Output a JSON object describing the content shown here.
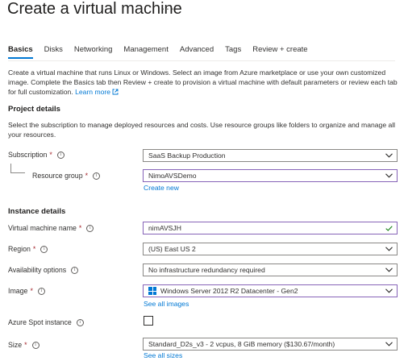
{
  "page": {
    "title": "Create a virtual machine",
    "more_label": "···"
  },
  "tabs": [
    {
      "label": "Basics",
      "active": true
    },
    {
      "label": "Disks"
    },
    {
      "label": "Networking"
    },
    {
      "label": "Management"
    },
    {
      "label": "Advanced"
    },
    {
      "label": "Tags"
    },
    {
      "label": "Review + create"
    }
  ],
  "intro": {
    "text": "Create a virtual machine that runs Linux or Windows. Select an image from Azure marketplace or use your own customized image. Complete the Basics tab then Review + create to provision a virtual machine with default parameters or review each tab for full customization.",
    "learn_more": "Learn more"
  },
  "project": {
    "heading": "Project details",
    "description": "Select the subscription to manage deployed resources and costs. Use resource groups like folders to organize and manage all your resources.",
    "subscription": {
      "label": "Subscription",
      "required": "*",
      "value": "SaaS Backup Production"
    },
    "resource_group": {
      "label": "Resource group",
      "required": "*",
      "value": "NimoAVSDemo",
      "create_new": "Create new"
    }
  },
  "instance": {
    "heading": "Instance details",
    "vm_name": {
      "label": "Virtual machine name",
      "required": "*",
      "value": "nimAVSJH"
    },
    "region": {
      "label": "Region",
      "required": "*",
      "value": "(US) East US 2"
    },
    "availability": {
      "label": "Availability options",
      "value": "No infrastructure redundancy required"
    },
    "image": {
      "label": "Image",
      "required": "*",
      "value": "Windows Server 2012 R2 Datacenter - Gen2",
      "see_all": "See all images"
    },
    "spot": {
      "label": "Azure Spot instance",
      "checked": false
    },
    "size": {
      "label": "Size",
      "required": "*",
      "value": "Standard_D2s_v3 - 2 vcpus, 8 GiB memory ($130.67/month)",
      "see_all": "See all sizes"
    }
  },
  "icons": {
    "info": "info-icon",
    "chevron": "chevron-down-icon",
    "check": "checkmark-icon",
    "windows": "windows-icon",
    "external": "external-link-icon"
  },
  "colors": {
    "accent": "#0078d4",
    "required": "#a4262c",
    "focus_border": "#8764b8",
    "valid_check": "#107c10"
  }
}
